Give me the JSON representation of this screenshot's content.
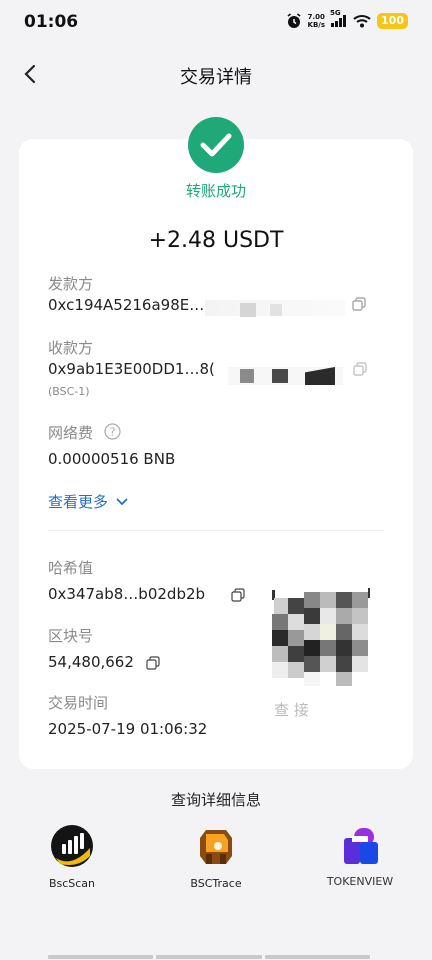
{
  "status_bar": {
    "time": "01:06",
    "net_speed_value": "7.00",
    "net_speed_unit": "KB/s",
    "signal_label": "5G",
    "battery": "100"
  },
  "header": {
    "title": "交易详情"
  },
  "transaction": {
    "status": "转账成功",
    "amount": "+2.48 USDT",
    "sender_label": "发款方",
    "sender_address": "0xc194A5216a98E…",
    "receiver_label": "收款方",
    "receiver_address": "0x9ab1E3E00DD1…8(",
    "receiver_network": "(BSC-1)",
    "fee_label": "网络费",
    "fee_value": "0.00000516 BNB",
    "see_more": "查看更多",
    "hash_label": "哈希值",
    "hash_value": "0x347ab8…b02db2b",
    "block_label": "区块号",
    "block_value": "54,480,662",
    "time_label": "交易时间",
    "time_value": "2025-07-19 01:06:32",
    "qr_caption": "查   接"
  },
  "explorers": {
    "title": "查询详细信息",
    "items": [
      {
        "label": "BscScan",
        "icon": "bscscan-logo"
      },
      {
        "label": "BSCTrace",
        "icon": "bsctrace-logo"
      },
      {
        "label": "TOKENVIEW",
        "icon": "tokenview-logo"
      }
    ]
  },
  "colors": {
    "success": "#1fa878",
    "link": "#1f6fd1",
    "battery": "#f5c518",
    "background": "#f3f3f5"
  }
}
